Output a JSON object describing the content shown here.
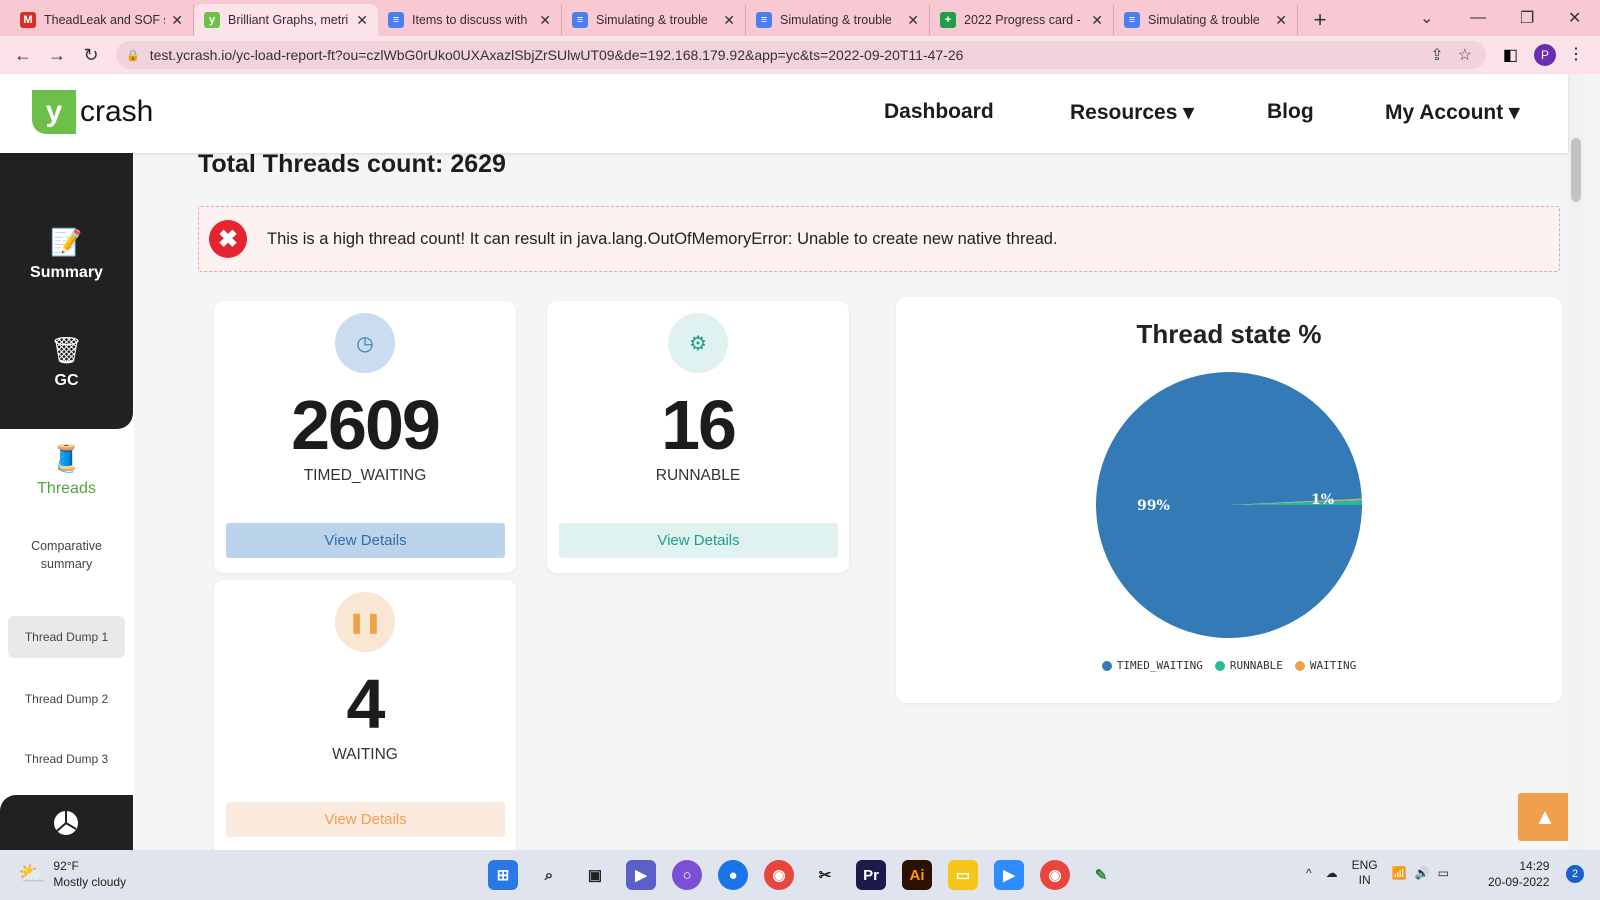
{
  "browser": {
    "tabs": [
      {
        "title": "TheadLeak and SOF s",
        "fav": "M",
        "color": "#d93025"
      },
      {
        "title": "Brilliant Graphs, metri",
        "fav": "y",
        "color": "#6cc04a"
      },
      {
        "title": "Items to discuss with",
        "fav": "≡",
        "color": "#4a7ee8"
      },
      {
        "title": "Simulating & trouble",
        "fav": "≡",
        "color": "#4a7ee8"
      },
      {
        "title": "Simulating & trouble",
        "fav": "≡",
        "color": "#4a7ee8"
      },
      {
        "title": "2022 Progress card -",
        "fav": "+",
        "color": "#1e9e4a"
      },
      {
        "title": "Simulating & trouble",
        "fav": "≡",
        "color": "#4a7ee8"
      }
    ],
    "url": "test.ycrash.io/yc-load-report-ft?ou=czlWbG0rUko0UXAxazlSbjZrSUlwUT09&de=192.168.179.92&app=yc&ts=2022-09-20T11-47-26",
    "profile_initial": "P"
  },
  "site": {
    "logo_y": "y",
    "logo_text": "crash",
    "nav": {
      "dashboard": "Dashboard",
      "resources": "Resources ▾",
      "blog": "Blog",
      "account": "My Account ▾"
    }
  },
  "sidebar": {
    "summary": "Summary",
    "gc": "GC",
    "threads": "Threads",
    "comparative": "Comparative summary",
    "dump1": "Thread Dump 1",
    "dump2": "Thread Dump 2",
    "dump3": "Thread Dump 3"
  },
  "main": {
    "total": "Total Threads count: 2629",
    "alert": "This is a high thread count! It can result in java.lang.OutOfMemoryError: Unable to create new native thread.",
    "cards": [
      {
        "count": "2609",
        "state": "TIMED_WAITING",
        "button": "View Details"
      },
      {
        "count": "16",
        "state": "RUNNABLE",
        "button": "View Details"
      },
      {
        "count": "4",
        "state": "WAITING",
        "button": "View Details"
      }
    ],
    "colors": {
      "timed_waiting": "#337ab7",
      "runnable": "#26b99a",
      "waiting": "#f0a04b"
    }
  },
  "chart_data": {
    "type": "pie",
    "title": "Thread state %",
    "categories": [
      "TIMED_WAITING",
      "RUNNABLE",
      "WAITING"
    ],
    "values": [
      2609,
      16,
      4
    ],
    "data_labels": [
      "99%",
      "1%"
    ],
    "legend": "bottom"
  },
  "taskbar": {
    "temp": "92°F",
    "weather": "Mostly cloudy",
    "lang1": "ENG",
    "lang2": "IN",
    "time": "14:29",
    "date": "20-09-2022",
    "notif": "2"
  }
}
